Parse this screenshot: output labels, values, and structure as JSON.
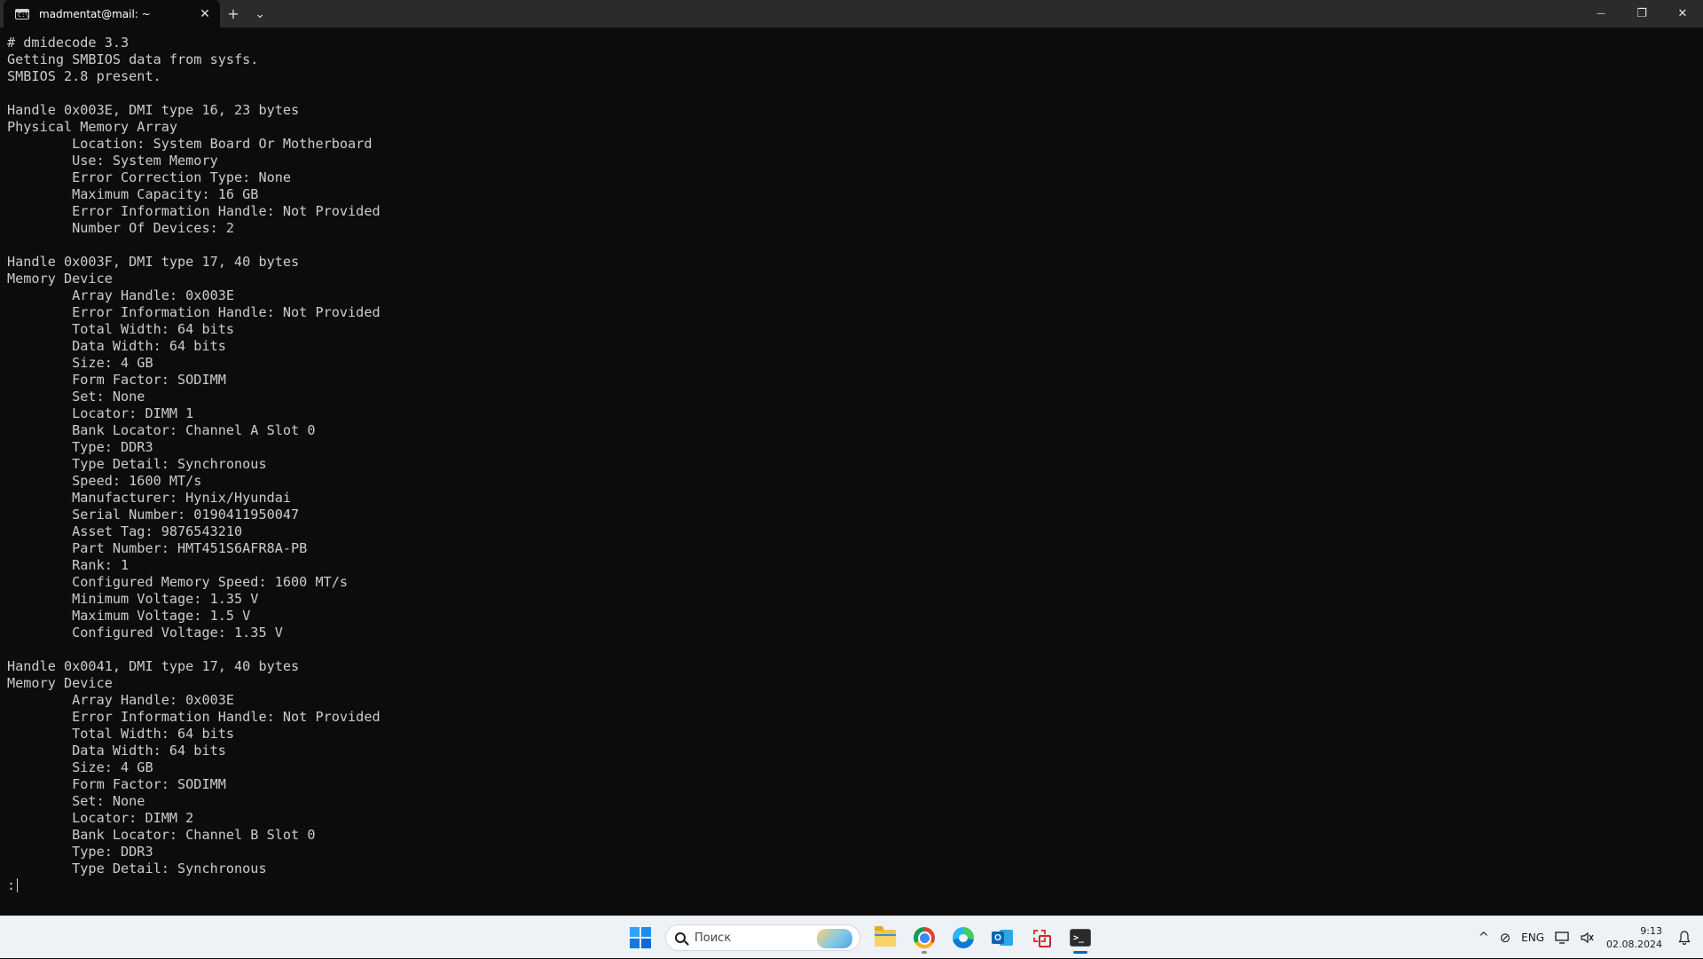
{
  "window": {
    "tab_title": "madmentat@mail: ~",
    "tab_icon_glyph": "C:\\",
    "tab_close_glyph": "✕",
    "new_tab_glyph": "+",
    "dropdown_glyph": "⌄",
    "minimize_glyph": "—",
    "maximize_glyph": "❐",
    "close_glyph": "✕"
  },
  "terminal": {
    "lines": [
      "# dmidecode 3.3",
      "Getting SMBIOS data from sysfs.",
      "SMBIOS 2.8 present.",
      "",
      "Handle 0x003E, DMI type 16, 23 bytes",
      "Physical Memory Array",
      "        Location: System Board Or Motherboard",
      "        Use: System Memory",
      "        Error Correction Type: None",
      "        Maximum Capacity: 16 GB",
      "        Error Information Handle: Not Provided",
      "        Number Of Devices: 2",
      "",
      "Handle 0x003F, DMI type 17, 40 bytes",
      "Memory Device",
      "        Array Handle: 0x003E",
      "        Error Information Handle: Not Provided",
      "        Total Width: 64 bits",
      "        Data Width: 64 bits",
      "        Size: 4 GB",
      "        Form Factor: SODIMM",
      "        Set: None",
      "        Locator: DIMM 1",
      "        Bank Locator: Channel A Slot 0",
      "        Type: DDR3",
      "        Type Detail: Synchronous",
      "        Speed: 1600 MT/s",
      "        Manufacturer: Hynix/Hyundai",
      "        Serial Number: 0190411950047",
      "        Asset Tag: 9876543210",
      "        Part Number: HMT451S6AFR8A-PB",
      "        Rank: 1",
      "        Configured Memory Speed: 1600 MT/s",
      "        Minimum Voltage: 1.35 V",
      "        Maximum Voltage: 1.5 V",
      "        Configured Voltage: 1.35 V",
      "",
      "Handle 0x0041, DMI type 17, 40 bytes",
      "Memory Device",
      "        Array Handle: 0x003E",
      "        Error Information Handle: Not Provided",
      "        Total Width: 64 bits",
      "        Data Width: 64 bits",
      "        Size: 4 GB",
      "        Form Factor: SODIMM",
      "        Set: None",
      "        Locator: DIMM 2",
      "        Bank Locator: Channel B Slot 0",
      "        Type: DDR3",
      "        Type Detail: Synchronous"
    ],
    "prompt": ":"
  },
  "taskbar": {
    "search_placeholder": "Поиск",
    "apps": [
      "start-icon",
      "search-icon",
      "file-explorer-icon",
      "chrome-icon",
      "edge-icon",
      "outlook-icon",
      "snipping-tool-icon",
      "terminal-icon"
    ],
    "tray": {
      "overflow_glyph": "^",
      "network_glyph": "⊘",
      "language": "ENG",
      "time": "9:13",
      "date": "02.08.2024",
      "bell_glyph": "🔔"
    }
  },
  "colors": {
    "terminal_bg": "#0c0c0c",
    "terminal_fg": "#cccccc",
    "titlebar_bg": "#2b2b2b",
    "taskbar_bg": "#eef1f6",
    "accent": "#0067c0"
  }
}
